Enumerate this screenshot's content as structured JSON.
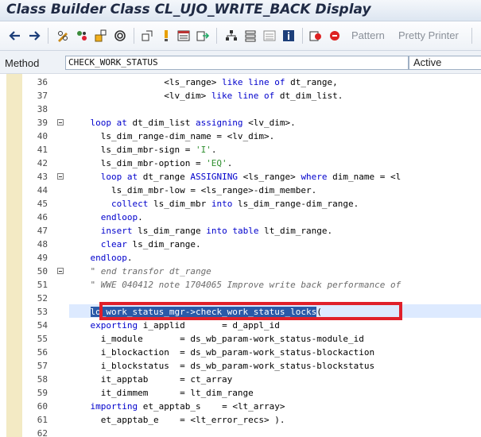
{
  "window": {
    "title": "Class Builder Class CL_UJO_WRITE_BACK Display"
  },
  "toolbar": {
    "icons": [
      "back-arrow-icon",
      "forward-arrow-icon",
      "pencil-glasses-icon",
      "activate-icon",
      "hierarchy-icon",
      "where-used-icon",
      "navigate-icon",
      "lamp-icon",
      "window-icon",
      "export-icon",
      "tree-icon",
      "stack-icon",
      "list-icon",
      "info-icon",
      "breakpoint-icon",
      "debug-icon"
    ],
    "pattern_label": "Pattern",
    "pretty_printer_label": "Pretty Printer"
  },
  "method_row": {
    "label": "Method",
    "value": "CHECK_WORK_STATUS",
    "status": "Active"
  },
  "editor": {
    "lines": [
      {
        "num": "36",
        "fold": false,
        "segments": [
          {
            "t": "                  <ls_range> ",
            "c": ""
          },
          {
            "t": "like line of",
            "c": "kw"
          },
          {
            "t": " dt_range,",
            "c": ""
          }
        ]
      },
      {
        "num": "37",
        "fold": false,
        "segments": [
          {
            "t": "                  <lv_dim> ",
            "c": ""
          },
          {
            "t": "like line of",
            "c": "kw"
          },
          {
            "t": " dt_dim_list.",
            "c": ""
          }
        ]
      },
      {
        "num": "38",
        "fold": false,
        "segments": []
      },
      {
        "num": "39",
        "fold": true,
        "segments": [
          {
            "t": "    ",
            "c": ""
          },
          {
            "t": "loop at",
            "c": "kw"
          },
          {
            "t": " dt_dim_list ",
            "c": ""
          },
          {
            "t": "assigning",
            "c": "kw"
          },
          {
            "t": " <lv_dim>.",
            "c": ""
          }
        ]
      },
      {
        "num": "40",
        "fold": false,
        "segments": [
          {
            "t": "      ls_dim_range-dim_name = <lv_dim>.",
            "c": ""
          }
        ]
      },
      {
        "num": "41",
        "fold": false,
        "segments": [
          {
            "t": "      ls_dim_mbr-sign = ",
            "c": ""
          },
          {
            "t": "'I'",
            "c": "str"
          },
          {
            "t": ".",
            "c": ""
          }
        ]
      },
      {
        "num": "42",
        "fold": false,
        "segments": [
          {
            "t": "      ls_dim_mbr-option = ",
            "c": ""
          },
          {
            "t": "'EQ'",
            "c": "str"
          },
          {
            "t": ".",
            "c": ""
          }
        ]
      },
      {
        "num": "43",
        "fold": true,
        "segments": [
          {
            "t": "      ",
            "c": ""
          },
          {
            "t": "loop at",
            "c": "kw"
          },
          {
            "t": " dt_range ",
            "c": ""
          },
          {
            "t": "ASSIGNING",
            "c": "kw"
          },
          {
            "t": " <ls_range> ",
            "c": ""
          },
          {
            "t": "where",
            "c": "kw"
          },
          {
            "t": " dim_name = <l",
            "c": ""
          }
        ]
      },
      {
        "num": "44",
        "fold": false,
        "segments": [
          {
            "t": "        ls_dim_mbr-low = <ls_range>-dim_member.",
            "c": ""
          }
        ]
      },
      {
        "num": "45",
        "fold": false,
        "segments": [
          {
            "t": "        ",
            "c": ""
          },
          {
            "t": "collect",
            "c": "kw"
          },
          {
            "t": " ls_dim_mbr ",
            "c": ""
          },
          {
            "t": "into",
            "c": "kw"
          },
          {
            "t": " ls_dim_range-dim_range.",
            "c": ""
          }
        ]
      },
      {
        "num": "46",
        "fold": false,
        "segments": [
          {
            "t": "      ",
            "c": ""
          },
          {
            "t": "endloop",
            "c": "kw"
          },
          {
            "t": ".",
            "c": ""
          }
        ]
      },
      {
        "num": "47",
        "fold": false,
        "segments": [
          {
            "t": "      ",
            "c": ""
          },
          {
            "t": "insert",
            "c": "kw"
          },
          {
            "t": " ls_dim_range ",
            "c": ""
          },
          {
            "t": "into table",
            "c": "kw"
          },
          {
            "t": " lt_dim_range.",
            "c": ""
          }
        ]
      },
      {
        "num": "48",
        "fold": false,
        "segments": [
          {
            "t": "      ",
            "c": ""
          },
          {
            "t": "clear",
            "c": "kw"
          },
          {
            "t": " ls_dim_range.",
            "c": ""
          }
        ]
      },
      {
        "num": "49",
        "fold": false,
        "segments": [
          {
            "t": "    ",
            "c": ""
          },
          {
            "t": "endloop",
            "c": "kw"
          },
          {
            "t": ".",
            "c": ""
          }
        ]
      },
      {
        "num": "50",
        "fold": true,
        "segments": [
          {
            "t": "    \" end transfor dt_range",
            "c": "cmt"
          }
        ]
      },
      {
        "num": "51",
        "fold": false,
        "segments": [
          {
            "t": "    \" WWE 040412 note 1704065 Improve write back performance of",
            "c": "cmt"
          }
        ]
      },
      {
        "num": "52",
        "fold": false,
        "segments": []
      },
      {
        "num": "53",
        "fold": false,
        "segments": [
          {
            "t": "    ",
            "c": ""
          },
          {
            "t": "lo_work_status_mgr->check_work_status_locks",
            "c": "sel"
          },
          {
            "t": "(",
            "c": ""
          }
        ]
      },
      {
        "num": "54",
        "fold": false,
        "segments": [
          {
            "t": "    ",
            "c": ""
          },
          {
            "t": "exporting",
            "c": "kw"
          },
          {
            "t": " i_applid       = d_appl_id",
            "c": ""
          }
        ]
      },
      {
        "num": "55",
        "fold": false,
        "segments": [
          {
            "t": "      i_module       = ds_wb_param-work_status-module_id",
            "c": ""
          }
        ]
      },
      {
        "num": "56",
        "fold": false,
        "segments": [
          {
            "t": "      i_blockaction  = ds_wb_param-work_status-blockaction",
            "c": ""
          }
        ]
      },
      {
        "num": "57",
        "fold": false,
        "segments": [
          {
            "t": "      i_blockstatus  = ds_wb_param-work_status-blockstatus",
            "c": ""
          }
        ]
      },
      {
        "num": "58",
        "fold": false,
        "segments": [
          {
            "t": "      it_apptab      = ct_array",
            "c": ""
          }
        ]
      },
      {
        "num": "59",
        "fold": false,
        "segments": [
          {
            "t": "      it_dimmem      = lt_dim_range",
            "c": ""
          }
        ]
      },
      {
        "num": "60",
        "fold": false,
        "segments": [
          {
            "t": "    ",
            "c": ""
          },
          {
            "t": "importing",
            "c": "kw"
          },
          {
            "t": " et_apptab_s    = <lt_array>",
            "c": ""
          }
        ]
      },
      {
        "num": "61",
        "fold": false,
        "segments": [
          {
            "t": "      et_apptab_e    = <lt_error_recs> ).",
            "c": ""
          }
        ]
      },
      {
        "num": "62",
        "fold": false,
        "segments": []
      }
    ]
  }
}
